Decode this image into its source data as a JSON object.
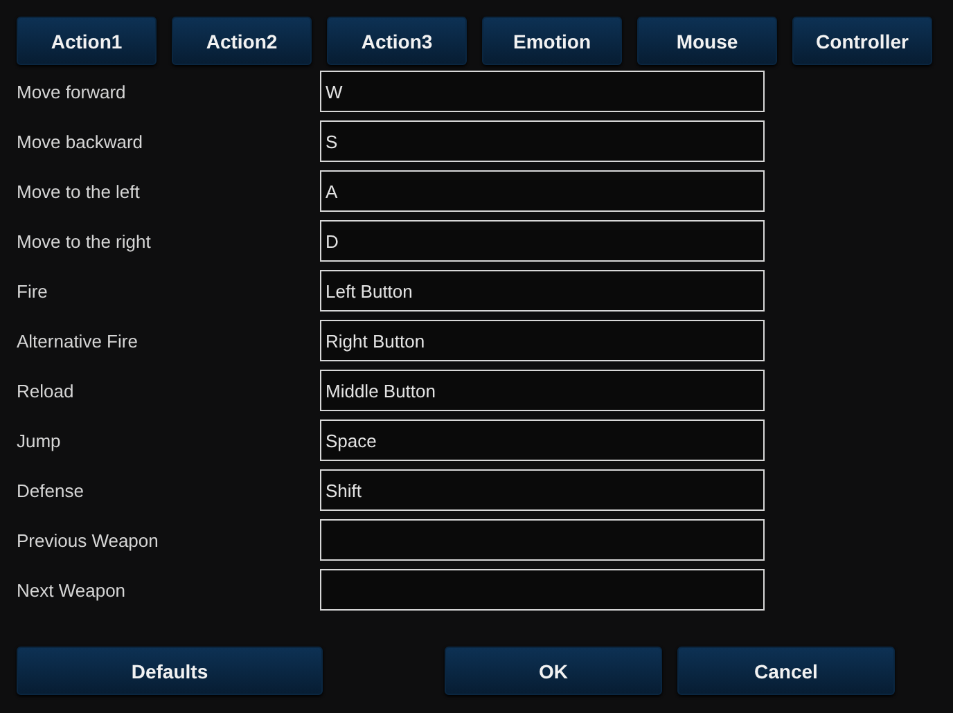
{
  "tabs": [
    {
      "label": "Action1"
    },
    {
      "label": "Action2"
    },
    {
      "label": "Action3"
    },
    {
      "label": "Emotion"
    },
    {
      "label": "Mouse"
    },
    {
      "label": "Controller"
    }
  ],
  "bindings": [
    {
      "action": "Move forward",
      "key": "W"
    },
    {
      "action": "Move backward",
      "key": "S"
    },
    {
      "action": "Move to the left",
      "key": "A"
    },
    {
      "action": "Move to the right",
      "key": "D"
    },
    {
      "action": "Fire",
      "key": "Left Button"
    },
    {
      "action": "Alternative Fire",
      "key": "Right Button"
    },
    {
      "action": "Reload",
      "key": "Middle Button"
    },
    {
      "action": "Jump",
      "key": "Space"
    },
    {
      "action": "Defense",
      "key": "Shift"
    },
    {
      "action": "Previous Weapon"
    },
    {
      "action": "Next Weapon"
    }
  ],
  "buttons": {
    "defaults": "Defaults",
    "ok": "OK",
    "cancel": "Cancel"
  }
}
